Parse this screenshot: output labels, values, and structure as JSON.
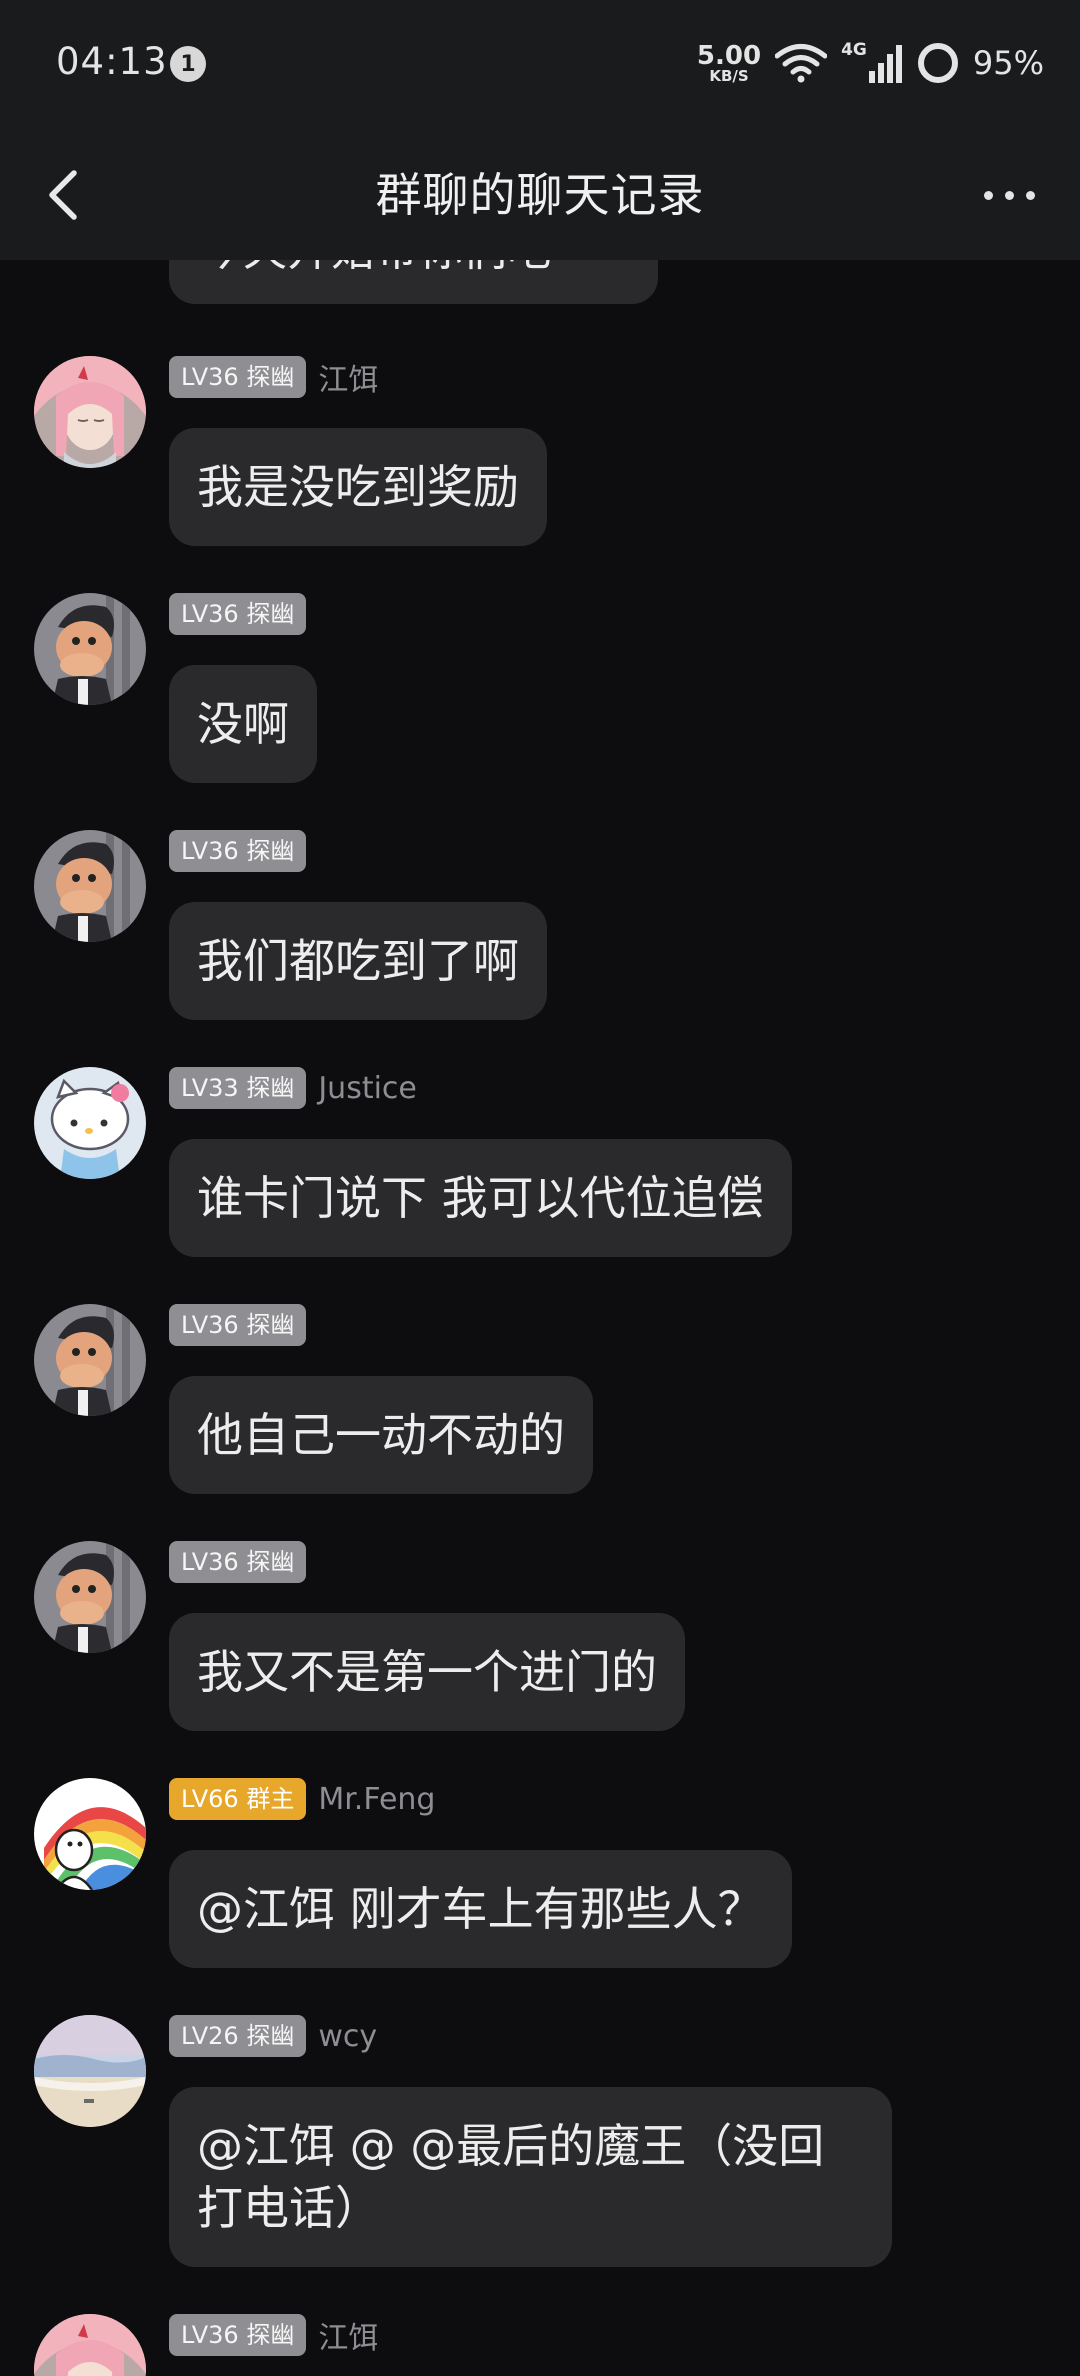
{
  "status_bar": {
    "time": "04:13",
    "notification_count": "1",
    "net_speed_value": "5.00",
    "net_speed_unit": "KB/S",
    "network_type": "4G",
    "battery_percent": "95%"
  },
  "header": {
    "title": "群聊的聊天记录",
    "back_icon": "chevron-left-icon",
    "more_icon": "more-dots-icon"
  },
  "partial_top_message": {
    "text": "今天开始带你们吧"
  },
  "messages": [
    {
      "badge": "LV36 探幽",
      "badge_type": "member",
      "nickname": "江饵",
      "text": "我是没吃到奖励",
      "avatar": "pink-hair-anime-girl"
    },
    {
      "badge": "LV36 探幽",
      "badge_type": "member",
      "nickname": "",
      "text": "没啊",
      "avatar": "cartoon-man"
    },
    {
      "badge": "LV36 探幽",
      "badge_type": "member",
      "nickname": "",
      "text": "我们都吃到了啊",
      "avatar": "cartoon-man"
    },
    {
      "badge": "LV33 探幽",
      "badge_type": "member",
      "nickname": "Justice",
      "text": "谁卡门说下 我可以代位追偿",
      "avatar": "hello-kitty"
    },
    {
      "badge": "LV36 探幽",
      "badge_type": "member",
      "nickname": "",
      "text": "他自己一动不动的",
      "avatar": "cartoon-man"
    },
    {
      "badge": "LV36 探幽",
      "badge_type": "member",
      "nickname": "",
      "text": "我又不是第一个进门的",
      "avatar": "cartoon-man"
    },
    {
      "badge": "LV66 群主",
      "badge_type": "owner",
      "nickname": "Mr.Feng",
      "text": "@江饵 刚才车上有那些人？",
      "avatar": "rainbow-meme"
    },
    {
      "badge": "LV26 探幽",
      "badge_type": "member",
      "nickname": "wcy",
      "text": "@江饵 @    @最后的魔王（没回打电话）",
      "avatar": "beach-landscape"
    },
    {
      "badge": "LV36 探幽",
      "badge_type": "member",
      "nickname": "江饵",
      "text": "",
      "avatar": "pink-hair-anime-girl"
    }
  ],
  "colors": {
    "background": "#0d0d0f",
    "bar": "#1a1b1d",
    "bubble": "#2a2a2d",
    "member_badge": "#8f8f93",
    "owner_badge": "#e7a72b"
  }
}
